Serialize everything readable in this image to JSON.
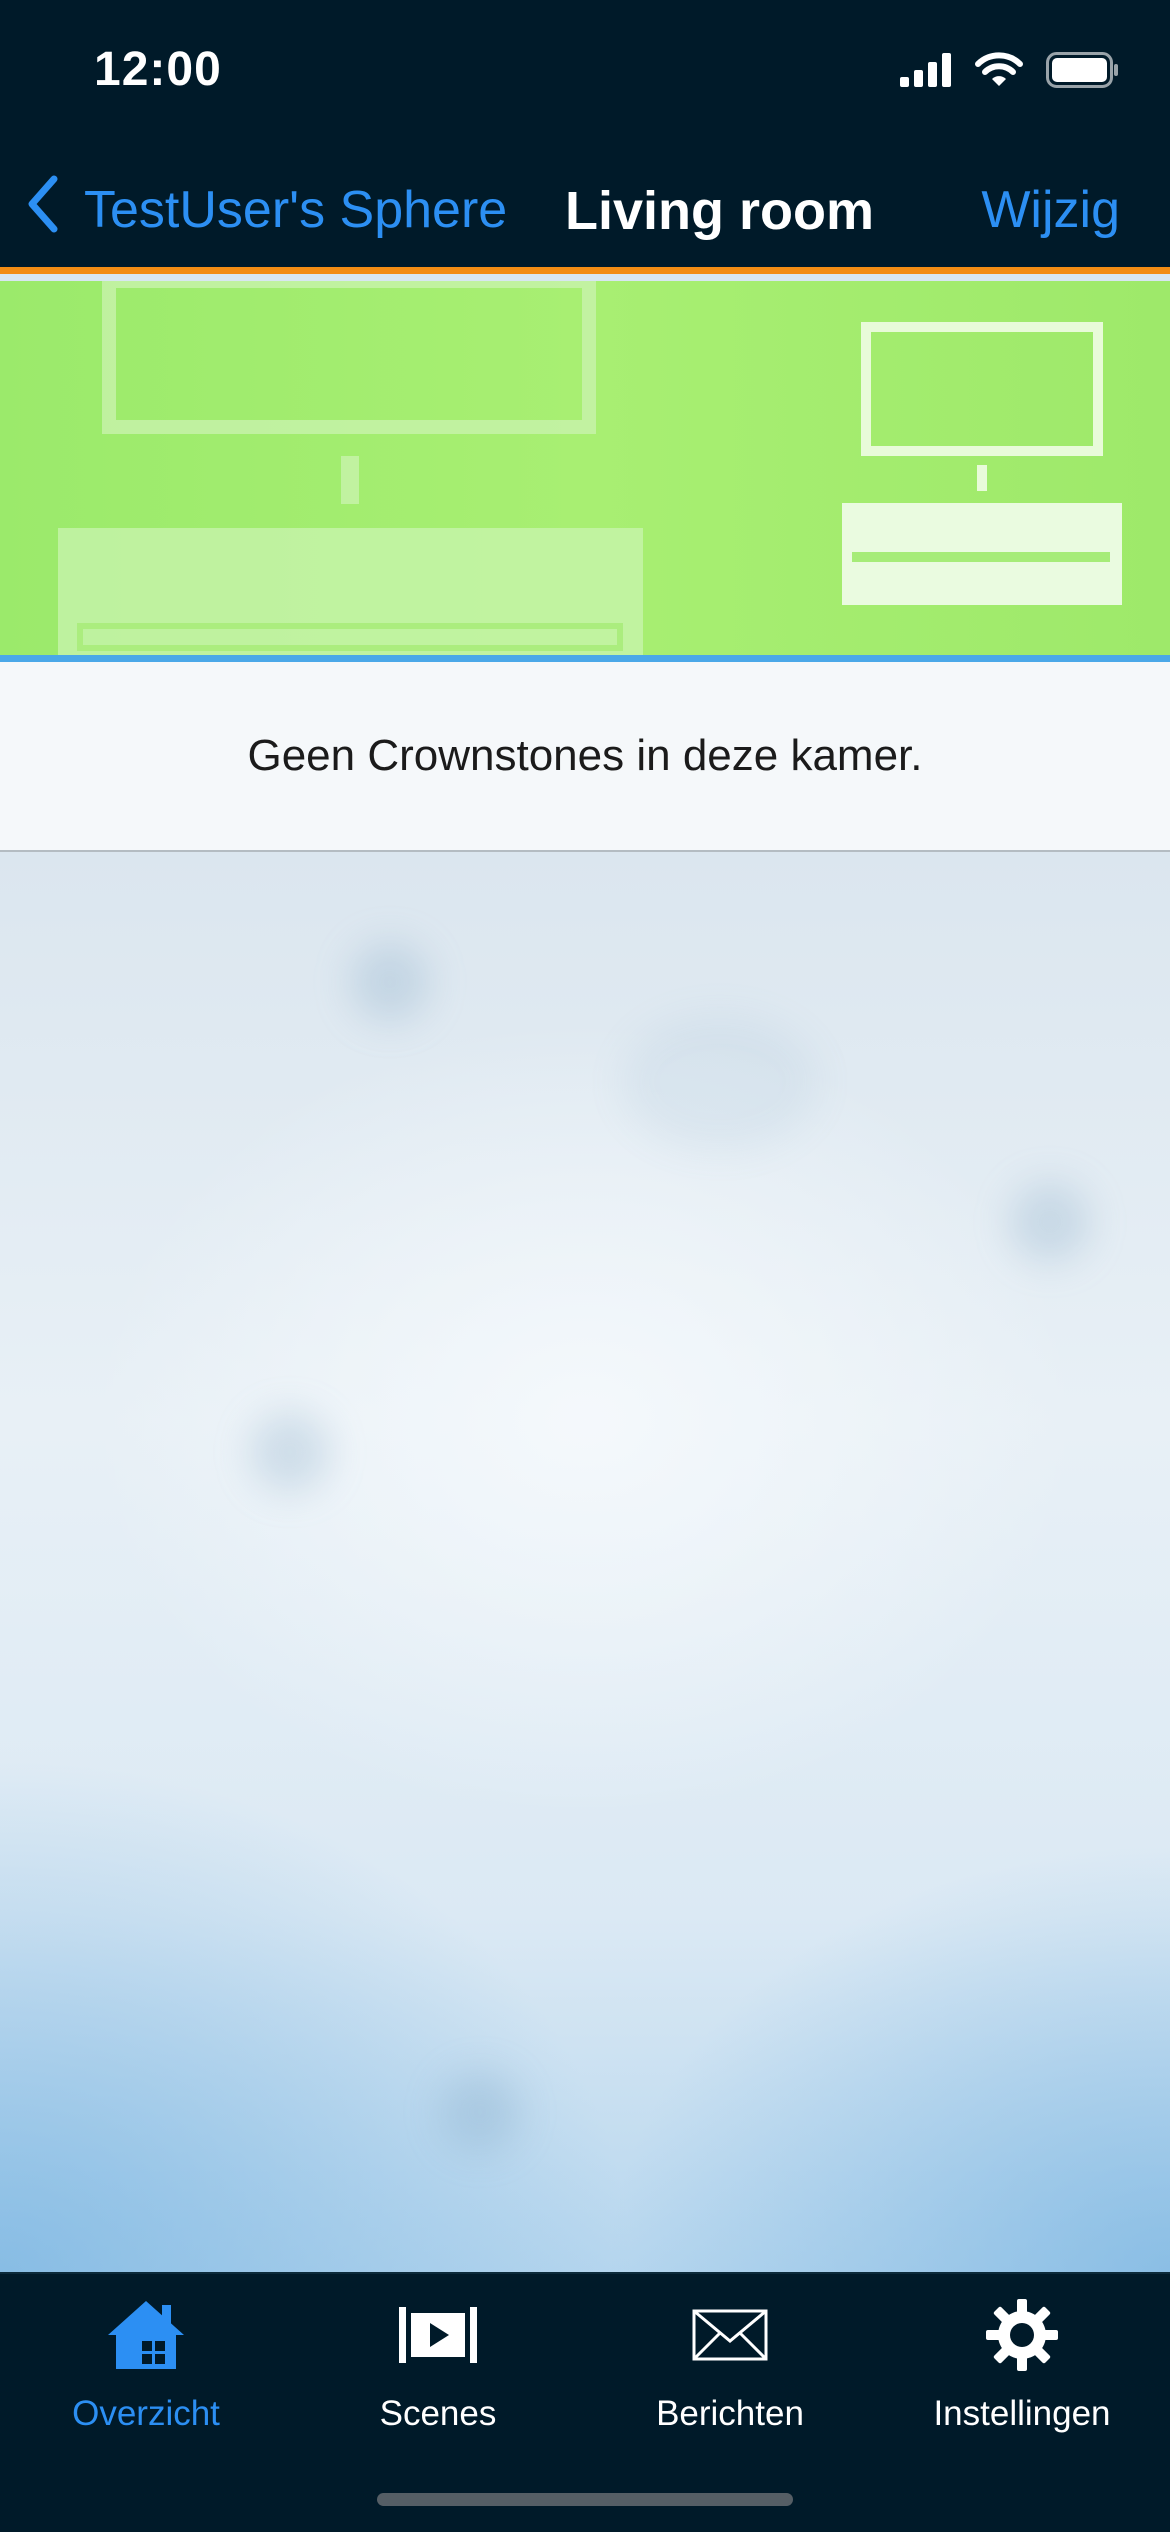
{
  "status_bar": {
    "time": "12:00",
    "icons": [
      "cellular-signal-icon",
      "wifi-icon",
      "battery-icon"
    ]
  },
  "nav": {
    "back_label": "TestUser's Sphere",
    "title": "Living room",
    "edit_label": "Wijzig"
  },
  "room": {
    "empty_message": "Geen Crownstones in deze kamer.",
    "banner_color": "#a4ed70",
    "divider_color": "#4aa8e8",
    "accent_color": "#f28c14"
  },
  "tabs": [
    {
      "label": "Overzicht",
      "icon": "home-icon",
      "active": true
    },
    {
      "label": "Scenes",
      "icon": "scenes-icon",
      "active": false
    },
    {
      "label": "Berichten",
      "icon": "envelope-icon",
      "active": false
    },
    {
      "label": "Instellingen",
      "icon": "gear-icon",
      "active": false
    }
  ],
  "colors": {
    "nav_background": "#001a29",
    "link_blue": "#2c8ff3"
  }
}
